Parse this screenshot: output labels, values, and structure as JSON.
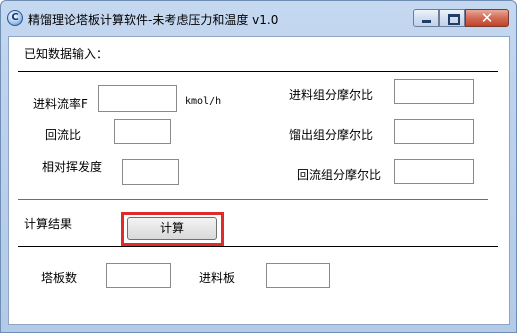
{
  "window": {
    "title": "精馏理论塔板计算软件-未考虑压力和温度 v1.0",
    "icon": "app-c-icon",
    "icon_glyph": "C",
    "buttons": {
      "minimize": "minimize",
      "maximize": "maximize",
      "close_glyph": "✕"
    }
  },
  "sections": {
    "input_header": "已知数据输入：",
    "result_header": "计算结果"
  },
  "inputs": {
    "feed_flow": {
      "label": "进料流率F",
      "unit": "kmol/h",
      "value": ""
    },
    "reflux_ratio": {
      "label": "回流比",
      "value": ""
    },
    "relative_volatility": {
      "label": "相对挥发度",
      "value": ""
    },
    "feed_mole_fraction": {
      "label": "进料组分摩尔比",
      "value": ""
    },
    "distillate_mole_fraction": {
      "label": "馏出组分摩尔比",
      "value": ""
    },
    "reflux_mole_fraction": {
      "label": "回流组分摩尔比",
      "value": ""
    }
  },
  "actions": {
    "calculate_label": "计算"
  },
  "results": {
    "plate_count": {
      "label": "塔板数",
      "value": ""
    },
    "feed_plate": {
      "label": "进料板",
      "value": ""
    }
  },
  "colors": {
    "highlight": "#e02b2b",
    "titlebar": "#bcd2ee"
  }
}
